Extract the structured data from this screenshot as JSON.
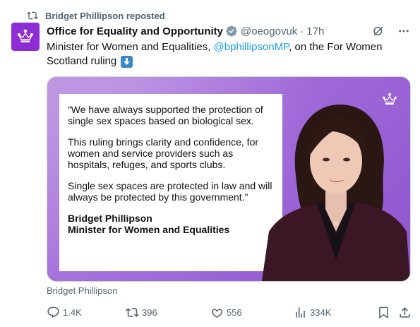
{
  "repost": {
    "text": "Bridget Phillipson reposted"
  },
  "tweet": {
    "display_name": "Office for Equality and Opportunity",
    "handle": "@oeogovuk",
    "separator": "·",
    "time": "17h",
    "text_before": "Minister for Women and Equalities, ",
    "mention": "@bphillipsonMP",
    "text_after": ", on the For Women Scotland ruling"
  },
  "media": {
    "quote_p1": "“We have always supported the protection of single sex spaces based on biological sex.",
    "quote_p2": "This ruling brings clarity and confidence, for women and service providers such as hospitals, refuges, and sports clubs.",
    "quote_p3": "Single sex spaces are protected in law and will always be protected by this government.”",
    "attrib_name": "Bridget Phillipson",
    "attrib_title": "Minister for Women and Equalities",
    "caption": "Bridget Phillipson"
  },
  "actions": {
    "replies": "1.4K",
    "reposts": "396",
    "likes": "556",
    "views": "334K"
  },
  "colors": {
    "brand_purple": "#8e2cd6",
    "link_blue": "#1d9bf0",
    "muted_gray": "#536471",
    "verified_gray": "#829aab"
  }
}
